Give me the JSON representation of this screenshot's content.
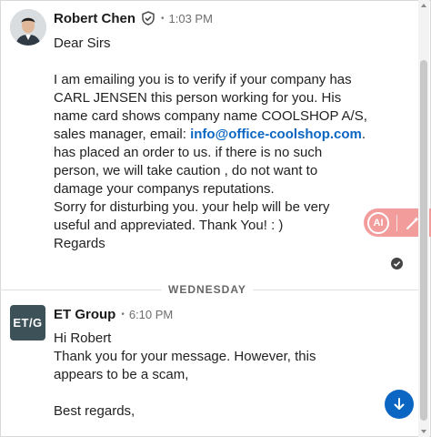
{
  "messages": [
    {
      "sender": "Robert Chen",
      "time": "1:03 PM",
      "dot": "•",
      "lines": {
        "greeting": "Dear Sirs",
        "p1_a": "I am emailing you is to verify if your company has CARL JENSEN this person working for you. His name card shows company name COOLSHOP A/S, sales manager, email: ",
        "email": "info@office-coolshop.com",
        "p1_b": ".",
        "p2": "has placed an order to us. if there is no such person, we will take caution , do not want to damage your companys reputations.",
        "p3": "Sorry for disturbing you. your help will be very useful and appreviated. Thank You! : )",
        "p4": "Regards"
      }
    },
    {
      "sender": "ET Group",
      "time": "6:10 PM",
      "dot": "•",
      "avatar_text": "ET/G",
      "lines": {
        "l1": "Hi Robert",
        "l2": "Thank you for your message. However, this appears to be a scam,",
        "l3": "Best regards,"
      }
    }
  ],
  "separator": {
    "label": "WEDNESDAY"
  },
  "ai_widget": {
    "label": "AI"
  },
  "colors": {
    "accent": "#0a66c2",
    "ai_pink": "#f29c9c",
    "logo_bg": "#3d5159"
  }
}
